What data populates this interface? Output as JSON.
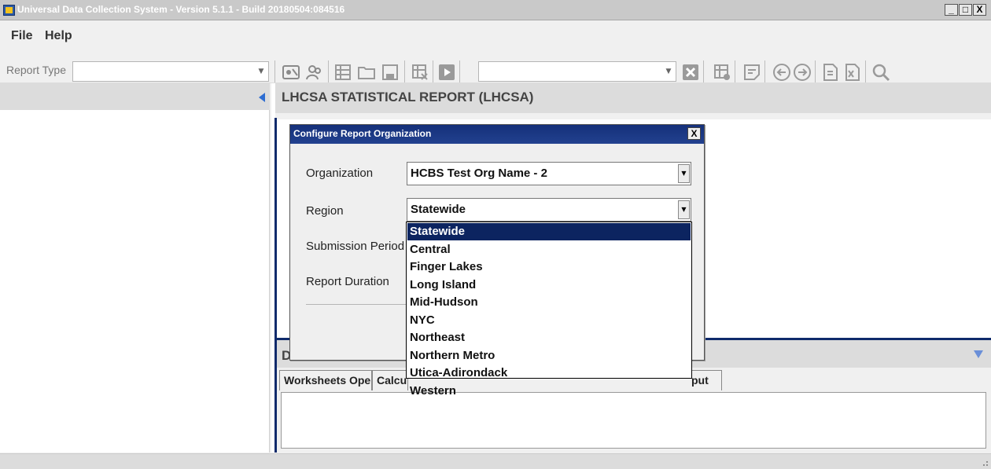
{
  "window": {
    "title": "Universal Data Collection System - Version 5.1.1 - Build 20180504:084516",
    "minimize": "_",
    "maximize": "□",
    "close": "X"
  },
  "menu": [
    "File",
    "Help"
  ],
  "toolbar": {
    "report_type_label": "Report Type",
    "report_type_value": "",
    "worksheet_value": ""
  },
  "report": {
    "title": "LHCSA STATISTICAL REPORT (LHCSA)"
  },
  "lower": {
    "header": "D"
  },
  "tabs": [
    "Worksheets Open",
    "Calculations",
    "put"
  ],
  "dialog": {
    "title": "Configure Report Organization",
    "close_label": "X",
    "organization_label": "Organization",
    "organization_value": "HCBS Test Org Name - 2",
    "region_label": "Region",
    "region_value": "Statewide",
    "submission_label": "Submission Period",
    "duration_label": "Report Duration"
  },
  "region_options": [
    "Statewide",
    "Central",
    "Finger Lakes",
    "Long Island",
    "Mid-Hudson",
    "NYC",
    "Northeast",
    "Northern Metro",
    "Utica-Adirondack",
    "Western"
  ],
  "region_selected": "Statewide",
  "colors": {
    "accent": "#0f2a6b",
    "selection": "#0c2460"
  }
}
